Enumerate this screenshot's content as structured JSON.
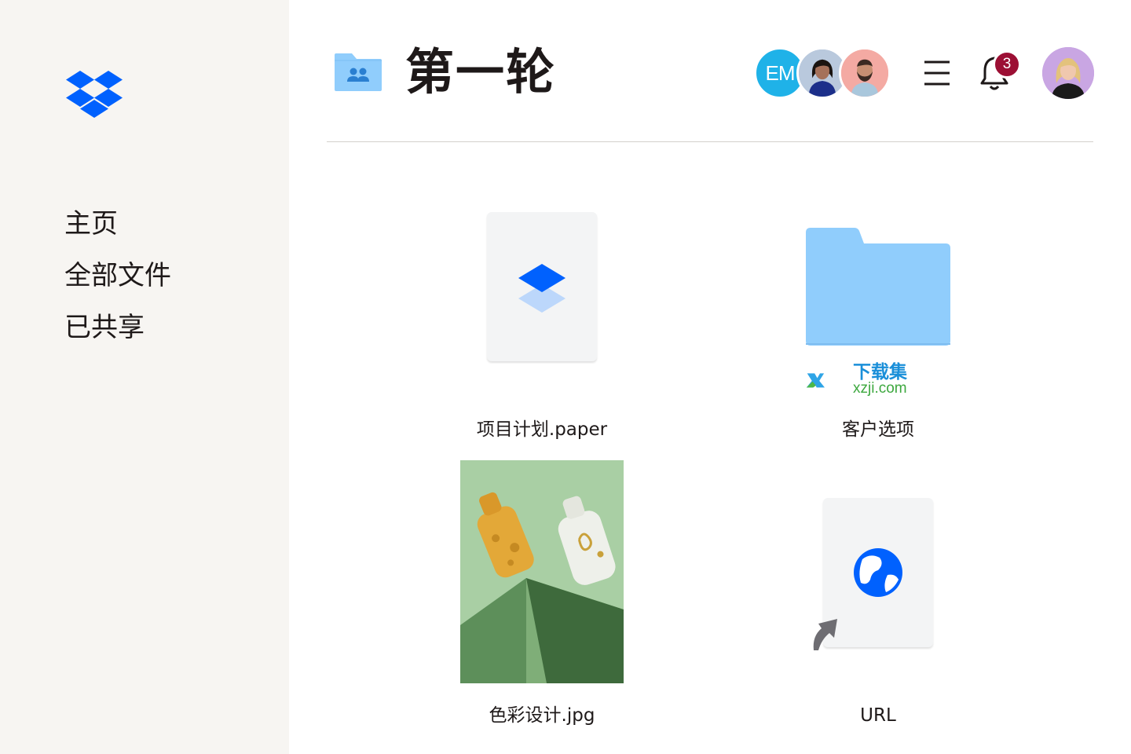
{
  "sidebar": {
    "logo_icon": "dropbox-logo-icon",
    "items": [
      {
        "label": "主页"
      },
      {
        "label": "全部文件"
      },
      {
        "label": "已共享"
      }
    ]
  },
  "header": {
    "folder_icon": "shared-folder-icon",
    "title": "第一轮",
    "members": [
      {
        "initials": "EM",
        "color": "#1fb2e8"
      },
      {
        "icon": "member-avatar"
      },
      {
        "icon": "member-avatar"
      }
    ],
    "menu_icon": "menu-icon",
    "bell_icon": "bell-icon",
    "notification_count": "3",
    "user_avatar_icon": "user-avatar"
  },
  "files": [
    {
      "name": "项目计划.paper",
      "icon": "paper-doc-icon"
    },
    {
      "name": "客户选项",
      "icon": "folder-icon"
    },
    {
      "name": "色彩设计.jpg",
      "icon": "image-thumbnail"
    },
    {
      "name": "URL",
      "icon": "web-link-icon"
    }
  ],
  "watermark": {
    "title": "下载集",
    "domain": "xzji.com"
  },
  "colors": {
    "sidebar_bg": "#f7f5f2",
    "dropbox_blue": "#0061fe",
    "folder_blue": "#90cdfc",
    "badge_red": "#9c0f34"
  }
}
